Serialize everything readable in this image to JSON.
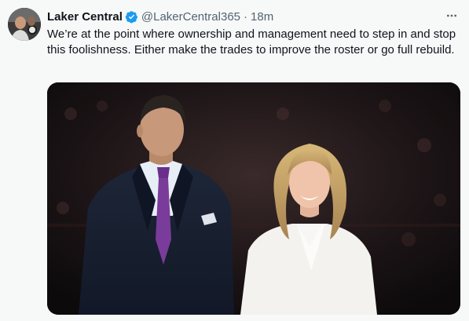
{
  "tweet": {
    "display_name": "Laker Central",
    "handle": "@LakerCentral365",
    "separator": "·",
    "timestamp": "18m",
    "text": "We’re at the point where ownership and management need to step in and stop this foolishness. Either make the trades to improve the roster or go full rebuild."
  },
  "icons": {
    "verified": "verified-badge-icon",
    "more": "more-options-icon",
    "avatar": "profile-avatar"
  },
  "colors": {
    "verified_blue": "#1d9bf0",
    "secondary_text": "#536471",
    "background": "#f7f9f9"
  }
}
